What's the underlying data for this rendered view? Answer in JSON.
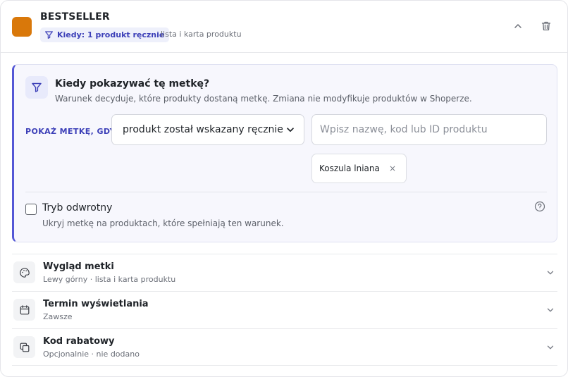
{
  "header": {
    "swatch_color": "#d9780a",
    "title": "BESTSELLER",
    "condition_pill": "Kiedy: 1 produkt ręcznie",
    "scope": "lista i karta produktu",
    "collapse_icon": "chevron-up-icon",
    "delete_icon": "trash-icon"
  },
  "condition": {
    "title": "Kiedy pokazywać tę metkę?",
    "description": "Warunek decyduje, które produkty dostaną metkę. Zmiana nie modyfikuje produktów w Shoperze.",
    "show_label": "POKAŻ METKĘ, GDY",
    "rule_select": "produkt został wskazany ręcznie",
    "search_placeholder": "Wpisz nazwę, kod lub ID produktu",
    "selected_products": [
      {
        "label": "Koszula lniana",
        "remove": "×"
      }
    ],
    "inverse_mode": {
      "label": "Tryb odwrotny",
      "description": "Ukryj metkę na produktach, które spełniają ten warunek.",
      "checked": false
    }
  },
  "sections": [
    {
      "title": "Wygląd metki",
      "subtitle": "Lewy górny · lista i karta produktu",
      "icon": "palette-icon"
    },
    {
      "title": "Termin wyświetlania",
      "subtitle": "Zawsze",
      "icon": "calendar-icon"
    },
    {
      "title": "Kod rabatowy",
      "subtitle": "Opcjonalnie · nie dodano",
      "icon": "copy-icon"
    }
  ],
  "colors": {
    "accent": "#3d40b8",
    "accent_border": "#5457d6",
    "panel_bg": "#f7f7fd"
  }
}
